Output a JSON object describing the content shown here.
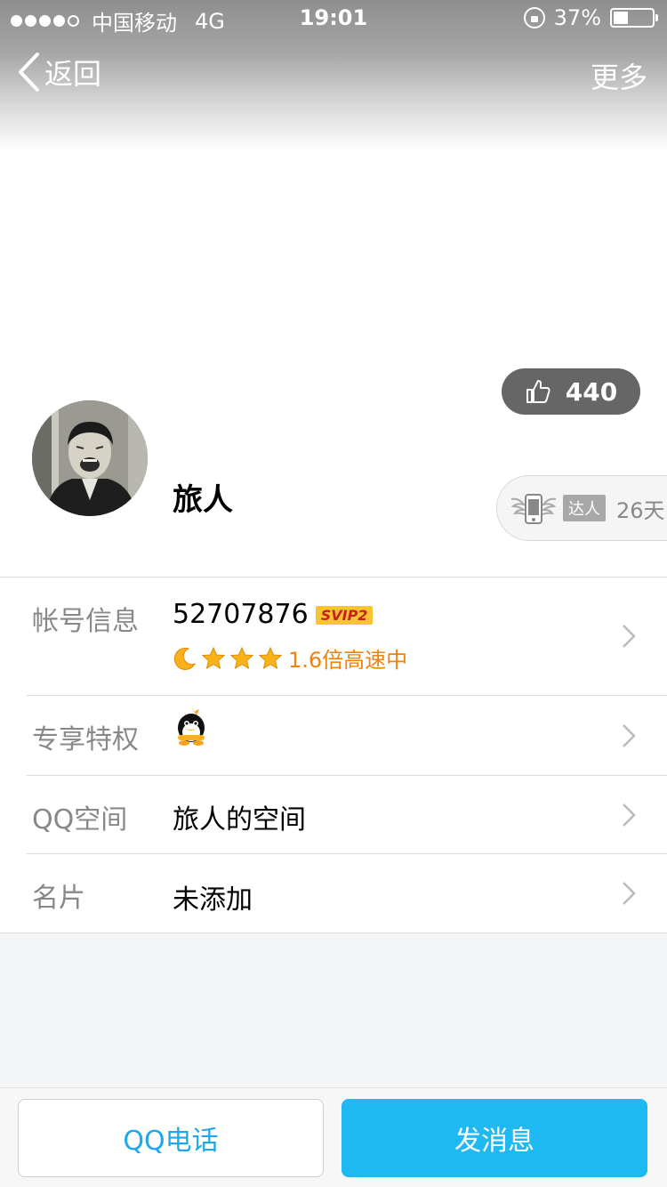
{
  "status_bar": {
    "carrier": "中国移动",
    "network": "4G",
    "time": "19:01",
    "battery": "37%",
    "battery_level": 0.37,
    "signal_bars": 4
  },
  "nav": {
    "back_label": "返回",
    "more_label": "更多"
  },
  "profile": {
    "likes": "440",
    "nickname": "旅人",
    "talent_tag": "达人",
    "talent_days": "26天"
  },
  "rows": {
    "account": {
      "label": "帐号信息",
      "qq_number": "52707876",
      "vip_badge": "SVIP2",
      "speed_text": "1.6倍高速中"
    },
    "privilege": {
      "label": "专享特权"
    },
    "qzone": {
      "label": "QQ空间",
      "value": "旅人的空间"
    },
    "card": {
      "label": "名片",
      "value": "未添加"
    }
  },
  "actions": {
    "call_label": "QQ电话",
    "message_label": "发消息"
  },
  "colors": {
    "accent_blue": "#1eb8f2",
    "call_text": "#1ea7ea",
    "speed_orange": "#f0830c",
    "label_gray": "#888888"
  }
}
